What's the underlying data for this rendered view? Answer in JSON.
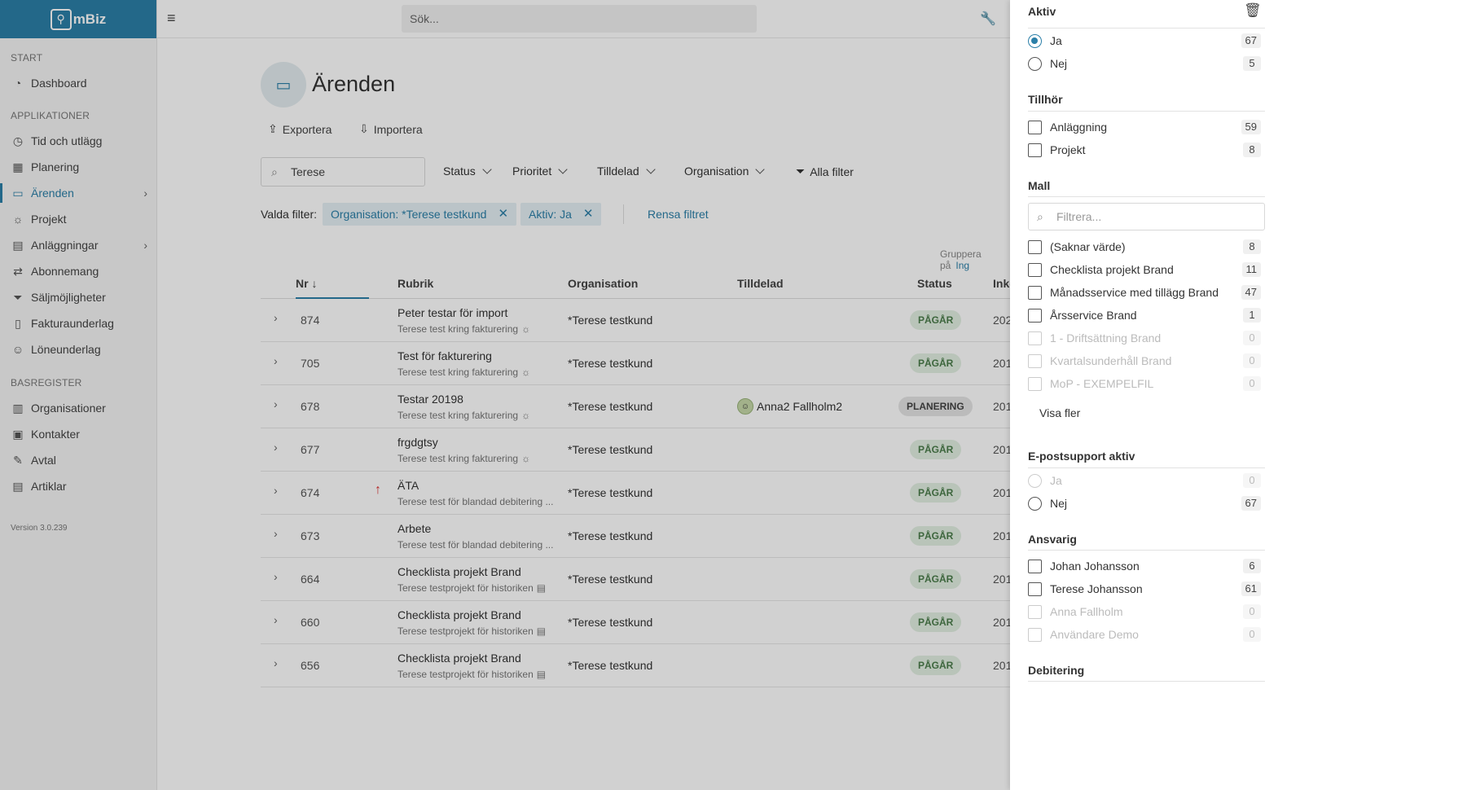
{
  "app": {
    "logo_text": "mBiz"
  },
  "sidebar": {
    "sections": [
      "START",
      "APPLIKATIONER",
      "BASREGISTER"
    ],
    "start_items": [
      {
        "label": "Dashboard",
        "icon": "dashboard-icon"
      }
    ],
    "app_items": [
      {
        "label": "Tid och utlägg",
        "icon": "clock-icon"
      },
      {
        "label": "Planering",
        "icon": "calendar-icon"
      },
      {
        "label": "Ärenden",
        "icon": "ticket-icon"
      },
      {
        "label": "Projekt",
        "icon": "lightbulb-icon"
      },
      {
        "label": "Anläggningar",
        "icon": "building-icon"
      },
      {
        "label": "Abonnemang",
        "icon": "repeat-icon"
      },
      {
        "label": "Säljmöjligheter",
        "icon": "funnel-icon"
      },
      {
        "label": "Fakturaunderlag",
        "icon": "invoice-icon"
      },
      {
        "label": "Löneunderlag",
        "icon": "user-check-icon"
      }
    ],
    "base_items": [
      {
        "label": "Organisationer",
        "icon": "office-icon"
      },
      {
        "label": "Kontakter",
        "icon": "contact-card-icon"
      },
      {
        "label": "Avtal",
        "icon": "contract-icon"
      },
      {
        "label": "Artiklar",
        "icon": "boxes-icon"
      }
    ],
    "version": "Version 3.0.239"
  },
  "topbar": {
    "search_placeholder": "Sök..."
  },
  "page": {
    "title": "Ärenden",
    "export_label": "Exportera",
    "import_label": "Importera",
    "search_value": "Terese",
    "filters": {
      "status": "Status",
      "prioritet": "Prioritet",
      "tilldelad": "Tilldelad",
      "organisation": "Organisation",
      "alla": "Alla filter"
    },
    "valda_label": "Valda filter:",
    "chip_org": "Organisation: *Terese testkund",
    "chip_aktiv": "Aktiv: Ja",
    "rensa": "Rensa filtret",
    "gruppera_label": "Gruppera på",
    "gruppera_value": "Ing"
  },
  "table": {
    "headers": {
      "nr": "Nr",
      "rubrik": "Rubrik",
      "organisation": "Organisation",
      "tilldelad": "Tilldelad",
      "status": "Status",
      "inkom": "Inko"
    },
    "rows": [
      {
        "nr": "874",
        "rubrik": "Peter testar för import",
        "sub": "Terese test kring fakturering",
        "org": "*Terese testkund",
        "assigned": "",
        "status": "PÅGÅR",
        "inkom": "202",
        "prio": "",
        "sub_icon": "lightbulb-icon"
      },
      {
        "nr": "705",
        "rubrik": "Test för fakturering",
        "sub": "Terese test kring fakturering",
        "org": "*Terese testkund",
        "assigned": "",
        "status": "PÅGÅR",
        "inkom": "201",
        "prio": "",
        "sub_icon": "lightbulb-icon"
      },
      {
        "nr": "678",
        "rubrik": "Testar 20198",
        "sub": "Terese test kring fakturering",
        "org": "*Terese testkund",
        "assigned": "Anna2 Fallholm2",
        "status": "PLANERING",
        "inkom": "201",
        "prio": "",
        "sub_icon": "lightbulb-icon"
      },
      {
        "nr": "677",
        "rubrik": "frgdgtsy",
        "sub": "Terese test kring fakturering",
        "org": "*Terese testkund",
        "assigned": "",
        "status": "PÅGÅR",
        "inkom": "201",
        "prio": "",
        "sub_icon": "lightbulb-icon"
      },
      {
        "nr": "674",
        "rubrik": "ÄTA",
        "sub": "Terese test för blandad debitering ...",
        "org": "*Terese testkund",
        "assigned": "",
        "status": "PÅGÅR",
        "inkom": "201",
        "prio": "↑",
        "sub_icon": ""
      },
      {
        "nr": "673",
        "rubrik": "Arbete",
        "sub": "Terese test för blandad debitering ...",
        "org": "*Terese testkund",
        "assigned": "",
        "status": "PÅGÅR",
        "inkom": "201",
        "prio": "",
        "sub_icon": ""
      },
      {
        "nr": "664",
        "rubrik": "Checklista projekt Brand",
        "sub": "Terese testprojekt för historiken",
        "org": "*Terese testkund",
        "assigned": "",
        "status": "PÅGÅR",
        "inkom": "201",
        "prio": "",
        "sub_icon": "building-icon"
      },
      {
        "nr": "660",
        "rubrik": "Checklista projekt Brand",
        "sub": "Terese testprojekt för historiken",
        "org": "*Terese testkund",
        "assigned": "",
        "status": "PÅGÅR",
        "inkom": "201",
        "prio": "",
        "sub_icon": "building-icon"
      },
      {
        "nr": "656",
        "rubrik": "Checklista projekt Brand",
        "sub": "Terese testprojekt för historiken",
        "org": "*Terese testkund",
        "assigned": "",
        "status": "PÅGÅR",
        "inkom": "201",
        "prio": "",
        "sub_icon": "building-icon"
      }
    ]
  },
  "panel": {
    "aktiv": {
      "title": "Aktiv",
      "options": [
        {
          "label": "Ja",
          "count": "67",
          "selected": true
        },
        {
          "label": "Nej",
          "count": "5",
          "selected": false
        }
      ]
    },
    "tillhor": {
      "title": "Tillhör",
      "options": [
        {
          "label": "Anläggning",
          "count": "59"
        },
        {
          "label": "Projekt",
          "count": "8"
        }
      ]
    },
    "mall": {
      "title": "Mall",
      "filter_placeholder": "Filtrera...",
      "options": [
        {
          "label": "(Saknar värde)",
          "count": "8",
          "disabled": false
        },
        {
          "label": "Checklista projekt Brand",
          "count": "11",
          "disabled": false
        },
        {
          "label": "Månadsservice med tillägg Brand",
          "count": "47",
          "disabled": false
        },
        {
          "label": "Årsservice Brand",
          "count": "1",
          "disabled": false
        },
        {
          "label": "1 - Driftsättning Brand",
          "count": "0",
          "disabled": true
        },
        {
          "label": "Kvartalsunderhåll Brand",
          "count": "0",
          "disabled": true
        },
        {
          "label": "MoP - EXEMPELFIL",
          "count": "0",
          "disabled": true
        }
      ],
      "show_more": "Visa fler"
    },
    "epost": {
      "title": "E-postsupport aktiv",
      "options": [
        {
          "label": "Ja",
          "count": "0",
          "disabled": true
        },
        {
          "label": "Nej",
          "count": "67",
          "disabled": false
        }
      ]
    },
    "ansvarig": {
      "title": "Ansvarig",
      "options": [
        {
          "label": "Johan Johansson",
          "count": "6",
          "disabled": false
        },
        {
          "label": "Terese Johansson",
          "count": "61",
          "disabled": false
        },
        {
          "label": "Anna Fallholm",
          "count": "0",
          "disabled": true
        },
        {
          "label": "Användare Demo",
          "count": "0",
          "disabled": true
        }
      ]
    },
    "debitering": {
      "title": "Debitering"
    }
  }
}
